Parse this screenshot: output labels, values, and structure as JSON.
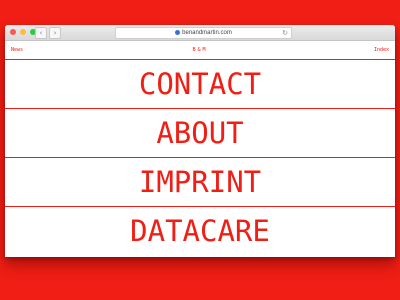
{
  "browser": {
    "url": "benandmartin.com",
    "back_glyph": "‹",
    "forward_glyph": "›",
    "reload_glyph": "↻"
  },
  "site": {
    "left_link": "News",
    "logo": "B&M",
    "right_link": "Index"
  },
  "menu": {
    "items": [
      {
        "label": "CONTACT"
      },
      {
        "label": "ABOUT"
      },
      {
        "label": "IMPRINT"
      },
      {
        "label": "DATACARE"
      }
    ]
  },
  "colors": {
    "accent": "#f01e14",
    "background": "#ffffff"
  }
}
